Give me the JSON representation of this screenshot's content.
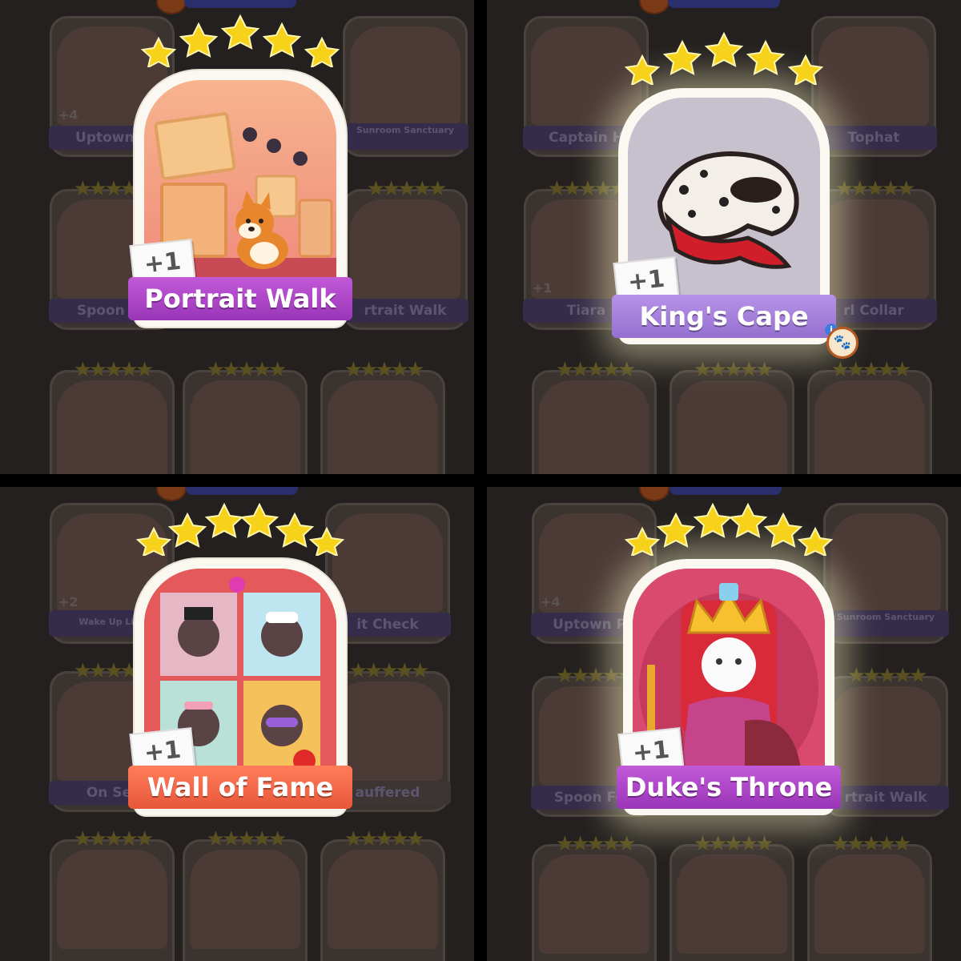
{
  "cards": [
    {
      "name": "Portrait Walk",
      "count": "+1",
      "stars": 5
    },
    {
      "name": "King's Cape",
      "count": "+1",
      "stars": 5
    },
    {
      "name": "Wall of Fame",
      "count": "+1",
      "stars": 5
    },
    {
      "name": "Duke's Throne",
      "count": "+1",
      "stars": 6
    }
  ],
  "background_cards": {
    "q1": [
      "Uptown P",
      "Sunroom Sanctuary",
      "Spoon Fe",
      "rtrait Walk",
      "+4"
    ],
    "q2": [
      "Captain H",
      "Tophat",
      "Tiara",
      "rl Collar",
      "+1"
    ],
    "q3": [
      "Wake Up Like",
      "it Check",
      "On Set",
      "auffered",
      "+2"
    ],
    "q4": [
      "Uptown Po",
      "Sunroom Sanctuary",
      "Spoon Fed",
      "rtrait Walk",
      "+4"
    ]
  },
  "icons": [
    "info-icon",
    "paw-icon",
    "star-icon"
  ],
  "colors": {
    "star": "#f6d21b",
    "purple_label": "#b048cc",
    "lilac_label": "#a883dd",
    "orange_label": "#f26a48"
  }
}
